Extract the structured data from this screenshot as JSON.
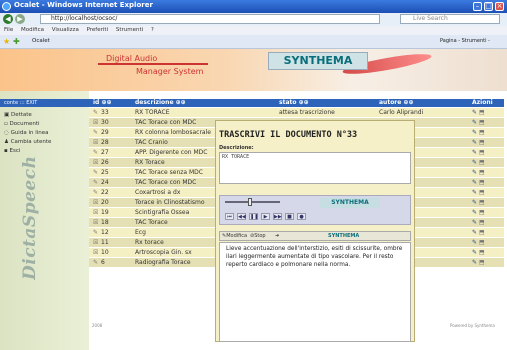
{
  "window": {
    "title": "Ocalet - Windows Internet Explorer"
  },
  "addressbar": {
    "url": "http://localhost/ocsoc/",
    "search_placeholder": "Live Search"
  },
  "menubar": {
    "items": [
      "File",
      "Modifica",
      "Visualizza",
      "Preferiti",
      "Strumenti",
      "?"
    ]
  },
  "favbar": {
    "tab": "Ocalet",
    "tools": "Pagina - Strumenti -"
  },
  "header": {
    "title_line1": "Digital Audio",
    "title_line2": "Manager System",
    "logo": "SYNTHEMA"
  },
  "sidebar": {
    "head": "conte ::: EXIT",
    "items": [
      "Dettate",
      "Documenti",
      "Guida in linea",
      "Cambia utente",
      "Esci"
    ],
    "brand": "DictaSpeech"
  },
  "table": {
    "headers": {
      "id": "id",
      "descrizione": "descrizione",
      "stato": "stato",
      "autore": "autore",
      "azioni": "Azioni"
    },
    "rows": [
      {
        "id": "33",
        "descrizione": "RX TORACE",
        "stato": "attesa trascrizione",
        "autore": "Carlo Aliprandi"
      },
      {
        "id": "30",
        "descrizione": "TAC Torace con MDC",
        "stato": "",
        "autore": ""
      },
      {
        "id": "29",
        "descrizione": "RX colonna lombosacrale",
        "stato": "",
        "autore": ""
      },
      {
        "id": "28",
        "descrizione": "TAC Cranio",
        "stato": "",
        "autore": ""
      },
      {
        "id": "27",
        "descrizione": "APP. Digerente con MDC",
        "stato": "",
        "autore": ""
      },
      {
        "id": "26",
        "descrizione": "RX Torace",
        "stato": "",
        "autore": ""
      },
      {
        "id": "25",
        "descrizione": "TAC Torace senza MDC",
        "stato": "",
        "autore": ""
      },
      {
        "id": "24",
        "descrizione": "TAC Torace con MDC",
        "stato": "",
        "autore": ""
      },
      {
        "id": "22",
        "descrizione": "Coxartrosi a dx",
        "stato": "",
        "autore": ""
      },
      {
        "id": "20",
        "descrizione": "Torace in Clinostatismo",
        "stato": "",
        "autore": ""
      },
      {
        "id": "19",
        "descrizione": "Scintigrafia Ossea",
        "stato": "",
        "autore": ""
      },
      {
        "id": "18",
        "descrizione": "TAC Torace",
        "stato": "",
        "autore": ""
      },
      {
        "id": "12",
        "descrizione": "Ecg",
        "stato": "",
        "autore": ""
      },
      {
        "id": "11",
        "descrizione": "Rx torace",
        "stato": "",
        "autore": ""
      },
      {
        "id": "10",
        "descrizione": "Artroscopia Gin. sx",
        "stato": "",
        "autore": ""
      },
      {
        "id": "6",
        "descrizione": "Radiografia Torace",
        "stato": "",
        "autore": ""
      }
    ]
  },
  "modal": {
    "title": "TRASCRIVI IL DOCUMENTO N°33",
    "desc_label": "Descrizione:",
    "desc_value": "RX TORACE",
    "player_logo": "SYNTHEMA",
    "toolbar": [
      "Modifica",
      "Stop"
    ],
    "text": "Lieve accentuazione dell'interstizio,  esiti di scissurite, ombre ilari leggermente aumentate di tipo vascolare. Per il resto reperto cardiaco e polmonare nella norma."
  },
  "colors": {
    "header_bg": "#2d63b8",
    "row_odd": "#f5efc4",
    "row_even": "#e4e0b4",
    "accent": "#c33"
  }
}
